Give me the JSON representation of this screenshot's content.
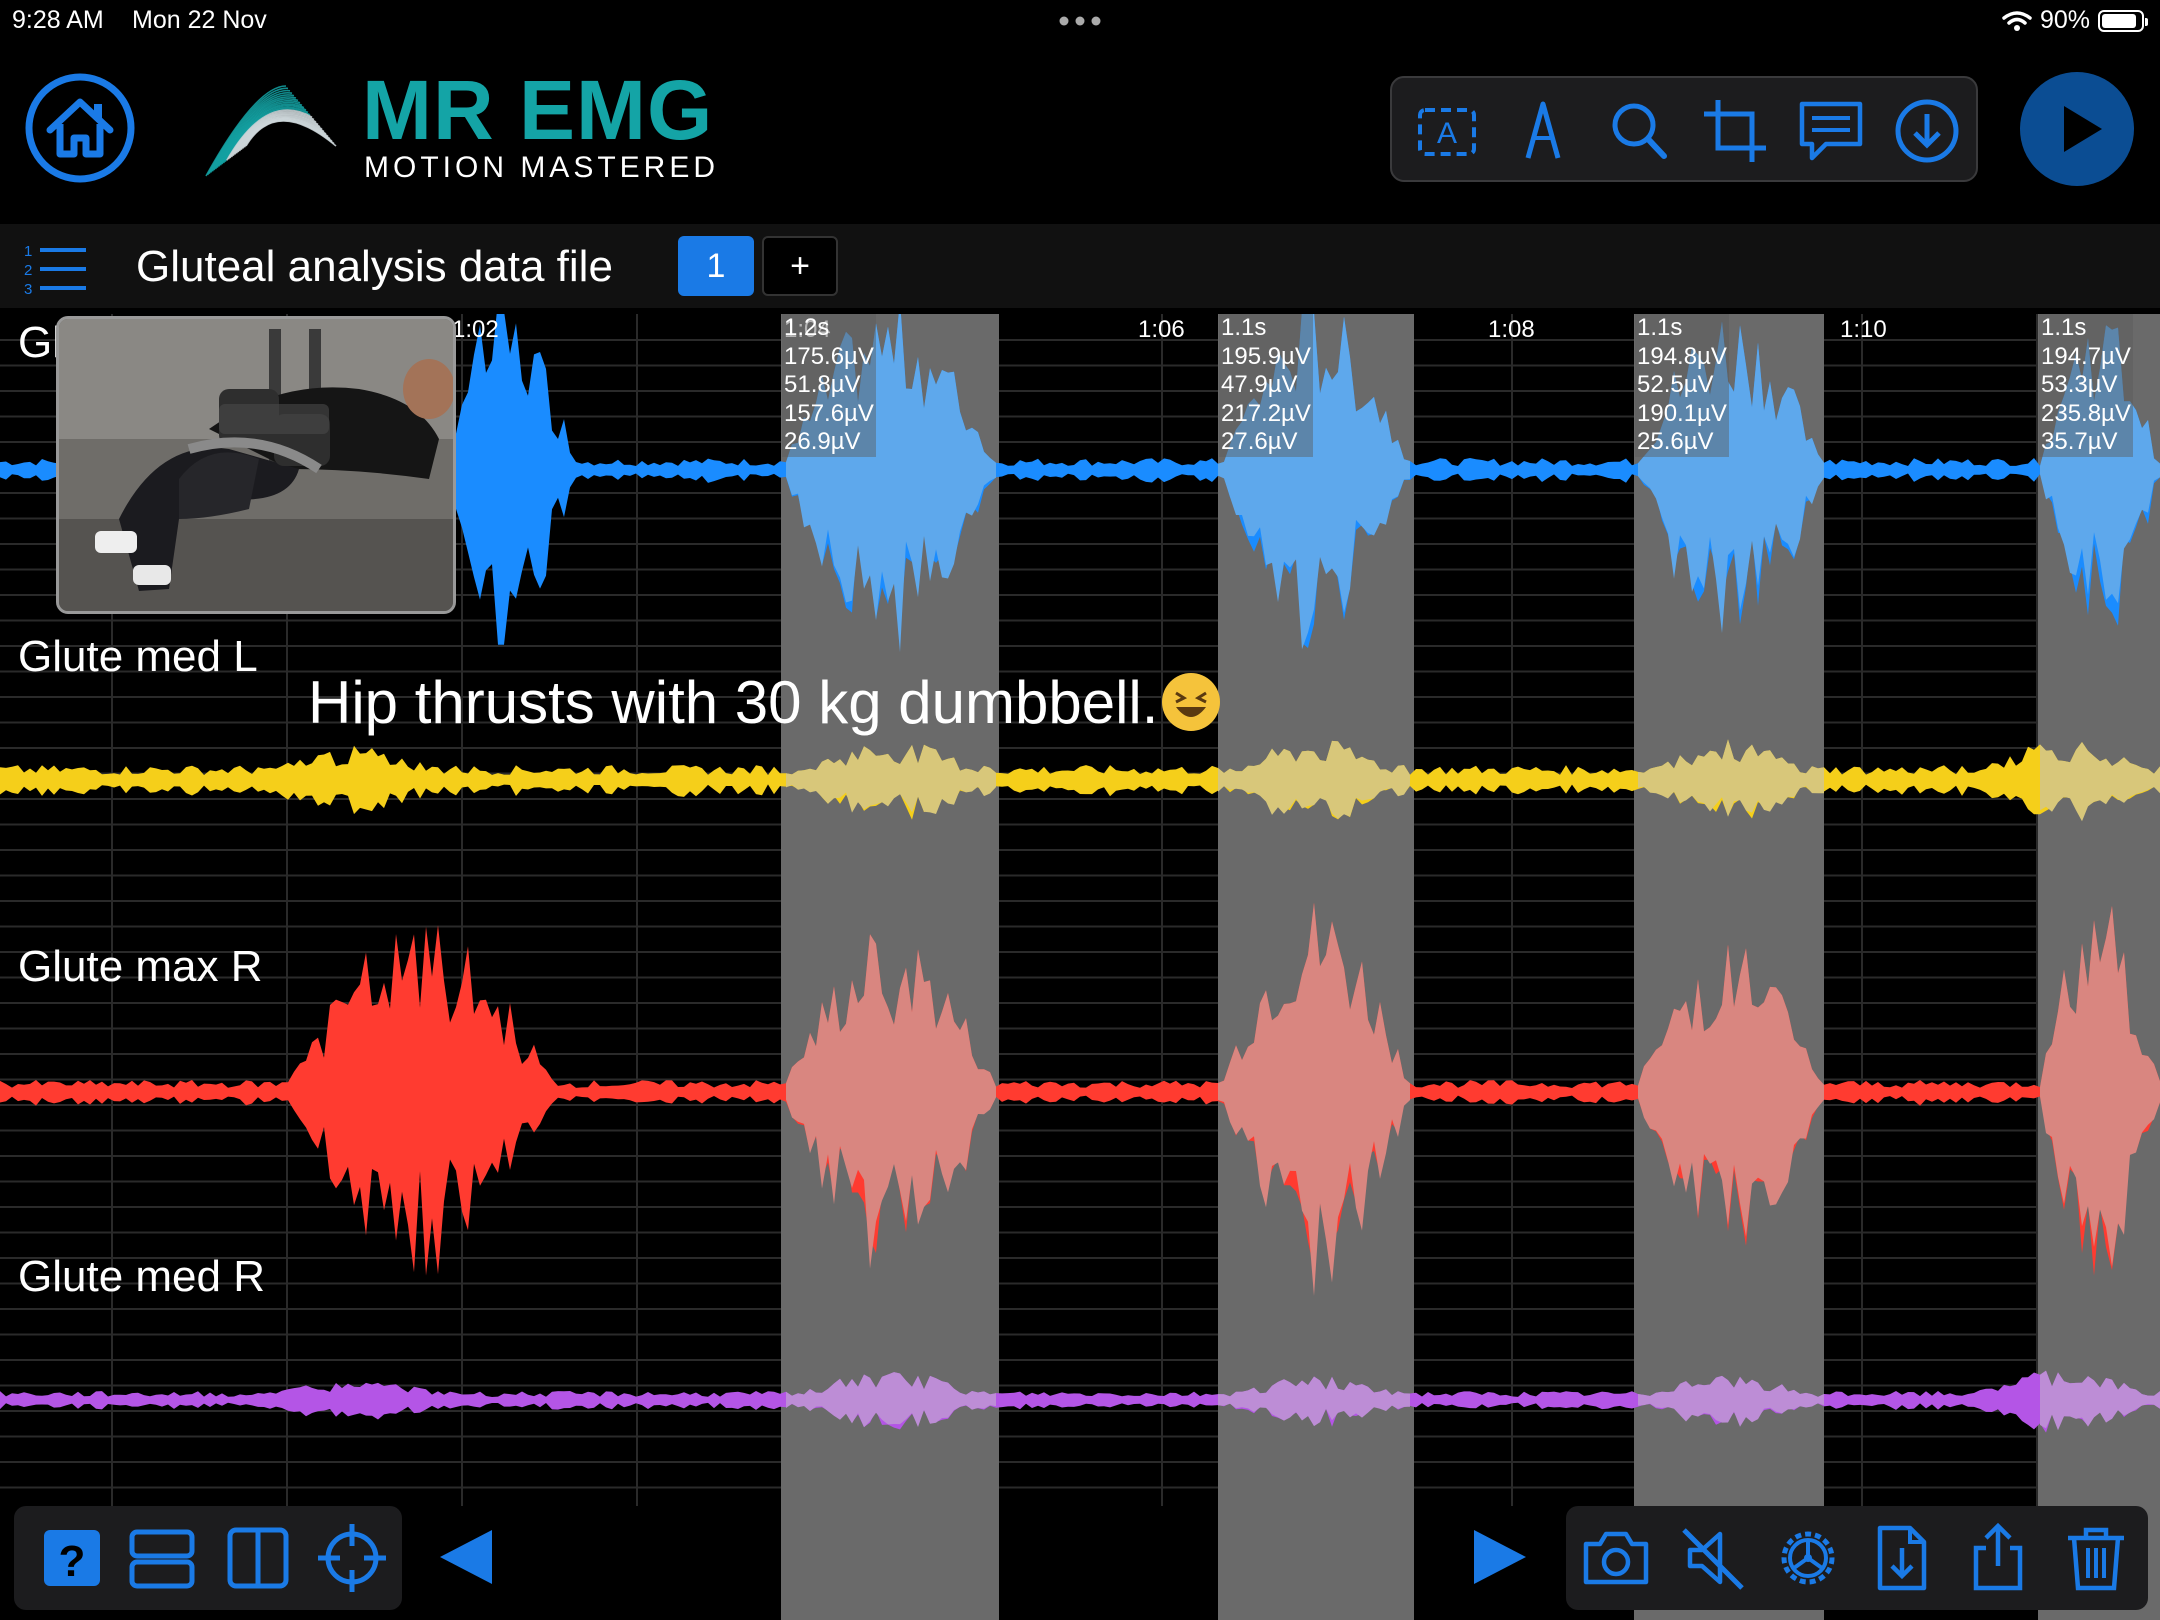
{
  "status_bar": {
    "time": "9:28 AM",
    "date": "Mon 22 Nov",
    "battery": "90%"
  },
  "brand": {
    "title": "MR EMG",
    "subtitle": "MOTION MASTERED",
    "teal": "#14a4a6"
  },
  "toolbar": {
    "icons": [
      "text-box-icon",
      "pen-icon",
      "search-icon",
      "crop-icon",
      "comment-icon",
      "download-icon"
    ]
  },
  "file": {
    "title": "Gluteal analysis data file",
    "pages": [
      "1",
      "+"
    ]
  },
  "channels": [
    {
      "label": "Glute max L",
      "color": "#1a8cff",
      "shaded_color": "#5ea8ec"
    },
    {
      "label": "Glute med L",
      "color": "#f5cf1a",
      "shaded_color": "#d8c77a"
    },
    {
      "label": "Glute max R",
      "color": "#ff3b30",
      "shaded_color": "#d98680"
    },
    {
      "label": "Glute med R",
      "color": "#b455e6",
      "shaded_color": "#bd8dd6"
    }
  ],
  "timeline": {
    "time_labels": [
      "1:02",
      "1:04",
      "1:06",
      "1:08",
      "1:10"
    ]
  },
  "segments": [
    {
      "duration": "1.2s",
      "values": [
        "175.6µV",
        "51.8µV",
        "157.6µV",
        "26.9µV"
      ]
    },
    {
      "duration": "1.1s",
      "values": [
        "195.9µV",
        "47.9µV",
        "217.2µV",
        "27.6µV"
      ]
    },
    {
      "duration": "1.1s",
      "values": [
        "194.8µV",
        "52.5µV",
        "190.1µV",
        "25.6µV"
      ]
    },
    {
      "duration": "1.1s",
      "values": [
        "194.7µV",
        "53.3µV",
        "235.8µV",
        "35.7µV"
      ]
    }
  ],
  "annotation": "Hip thrusts with 30 kg dumbbell.",
  "bottom_bar": {
    "left_icons": [
      "help-icon",
      "stacked-view-icon",
      "split-view-icon",
      "target-icon"
    ],
    "right_icons": [
      "camera-icon",
      "mute-icon",
      "settings-icon",
      "import-file-icon",
      "share-icon",
      "trash-icon"
    ]
  }
}
